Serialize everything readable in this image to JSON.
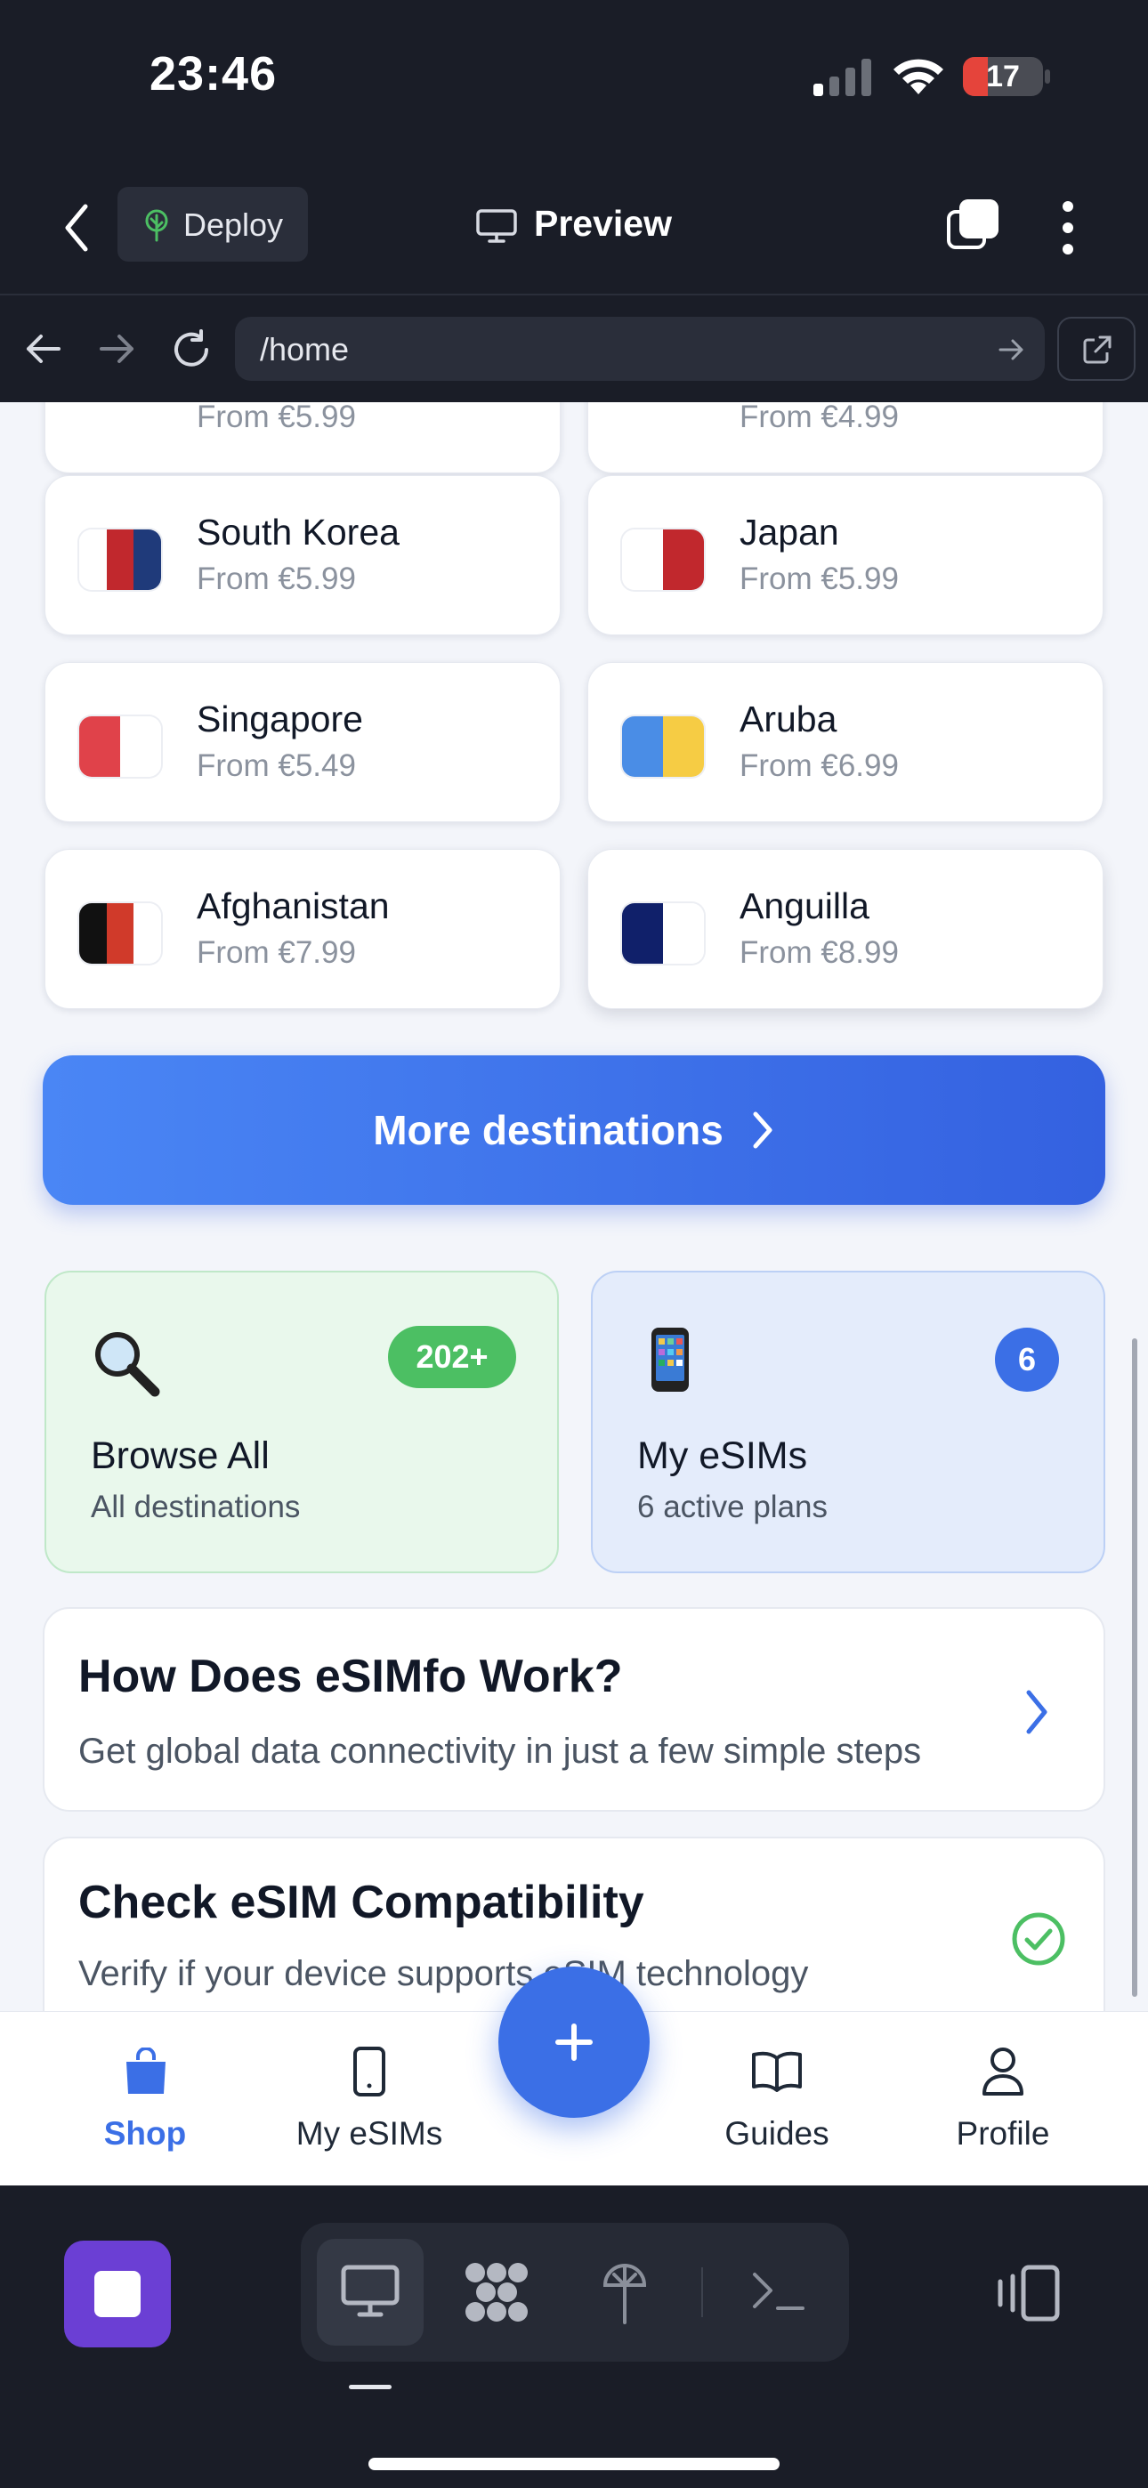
{
  "status_bar": {
    "time": "23:46",
    "battery": "17"
  },
  "app_bar": {
    "deploy_label": "Deploy",
    "preview_label": "Preview"
  },
  "url_bar": {
    "path": "/home"
  },
  "partial_row": {
    "left_price": "From €5.99",
    "right_price": "From €4.99"
  },
  "destinations": [
    {
      "name": "South Korea",
      "price": "From €5.99"
    },
    {
      "name": "Japan",
      "price": "From €5.99"
    },
    {
      "name": "Singapore",
      "price": "From €5.49"
    },
    {
      "name": "Aruba",
      "price": "From €6.99"
    },
    {
      "name": "Afghanistan",
      "price": "From €7.99"
    },
    {
      "name": "Anguilla",
      "price": "From €8.99"
    }
  ],
  "more_button": {
    "label": "More destinations"
  },
  "browse_tile": {
    "title": "Browse All",
    "subtitle": "All destinations",
    "badge": "202+",
    "icon": "magnifier-emoji"
  },
  "esims_tile": {
    "title": "My eSIMs",
    "subtitle": "6 active plans",
    "badge": "6",
    "icon": "phone-emoji"
  },
  "how_card": {
    "title": "How Does eSIMfo Work?",
    "subtitle": "Get global data connectivity in just a few simple steps"
  },
  "compat_card": {
    "title": "Check eSIM Compatibility",
    "subtitle": "Verify if your device supports eSIM technology"
  },
  "tabs": [
    {
      "label": "Shop",
      "icon": "bag-icon",
      "active": true
    },
    {
      "label": "My eSIMs",
      "icon": "phone-icon",
      "active": false
    },
    {
      "label": "Guides",
      "icon": "book-icon",
      "active": false
    },
    {
      "label": "Profile",
      "icon": "user-icon",
      "active": false
    }
  ],
  "colors": {
    "accent": "#3b6fe6",
    "success": "#4cbf63",
    "bg": "#f3f5fa",
    "chrome": "#1a1d27"
  }
}
